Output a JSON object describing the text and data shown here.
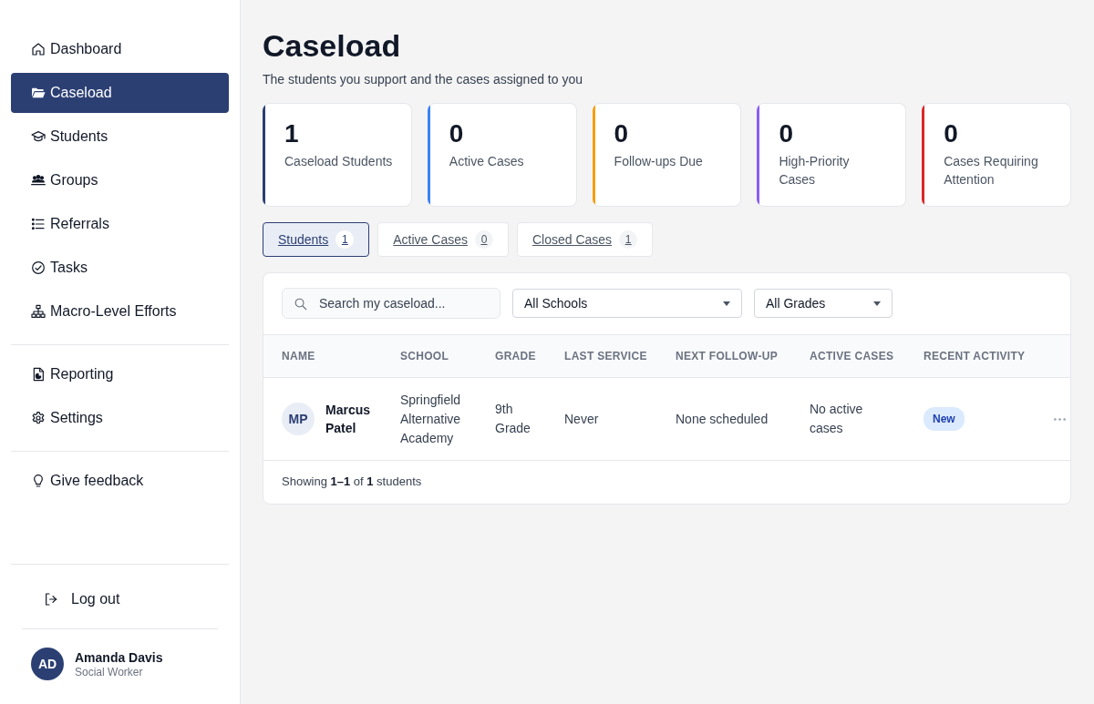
{
  "sidebar": {
    "sections": [
      {
        "items": [
          {
            "label": "Dashboard",
            "selected": false
          },
          {
            "label": "Caseload",
            "selected": true
          },
          {
            "label": "Students",
            "selected": false
          },
          {
            "label": "Groups",
            "selected": false
          },
          {
            "label": "Referrals",
            "selected": false
          },
          {
            "label": "Tasks",
            "selected": false
          },
          {
            "label": "Macro-Level Efforts",
            "selected": false
          }
        ]
      },
      {
        "items": [
          {
            "label": "Reporting",
            "selected": false
          },
          {
            "label": "Settings",
            "selected": false
          }
        ]
      },
      {
        "items": [
          {
            "label": "Give feedback",
            "selected": false
          }
        ]
      }
    ],
    "log_out": "Log out",
    "user": {
      "initials": "AD",
      "name": "Amanda Davis",
      "role": "Social Worker"
    }
  },
  "page": {
    "title": "Caseload",
    "subtitle": "The students you support and the cases assigned to you"
  },
  "stats": [
    {
      "value": "1",
      "label": "Caseload Students",
      "color": "#2b3f73"
    },
    {
      "value": "0",
      "label": "Active Cases",
      "color": "#3b82f6"
    },
    {
      "value": "0",
      "label": "Follow-ups Due",
      "color": "#f59e0b"
    },
    {
      "value": "0",
      "label": "High-Priority Cases",
      "color": "#8b5cf6"
    },
    {
      "value": "0",
      "label": "Cases Requiring Attention",
      "color": "#dc2626"
    }
  ],
  "tabs": [
    {
      "label": "Students",
      "count": "1",
      "selected": true
    },
    {
      "label": "Active Cases",
      "count": "0",
      "selected": false
    },
    {
      "label": "Closed Cases",
      "count": "1",
      "selected": false
    }
  ],
  "filters": {
    "search": {
      "placeholder": "Search my caseload..."
    },
    "selects": [
      {
        "value": "All Schools"
      },
      {
        "value": "All Grades"
      }
    ]
  },
  "table": {
    "columns": [
      "NAME",
      "SCHOOL",
      "GRADE",
      "LAST SERVICE",
      "NEXT FOLLOW-UP",
      "ACTIVE CASES",
      "RECENT ACTIVITY"
    ],
    "rows": [
      {
        "initials": "MP",
        "name": "Marcus Patel",
        "school": "Springfield Alternative Academy",
        "grade": "9th Grade",
        "last_service": "Never",
        "next_follow_up": "None scheduled",
        "active_cases": "No active cases",
        "recent_activity": "New"
      }
    ],
    "footer": "Showing **1–1** of **1** students"
  }
}
